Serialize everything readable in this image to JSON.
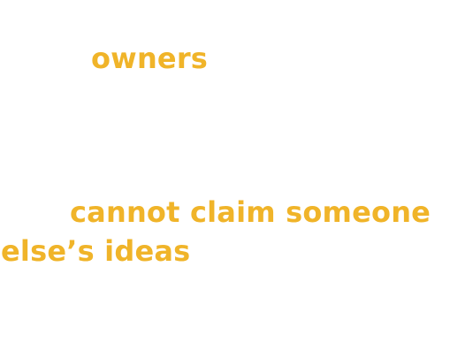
{
  "fragments": {
    "owners": "owners",
    "claim_line1": "cannot claim someone",
    "claim_line2": "else’s ideas"
  },
  "colors": {
    "text": "#f0b429",
    "background": "#ffffff"
  }
}
